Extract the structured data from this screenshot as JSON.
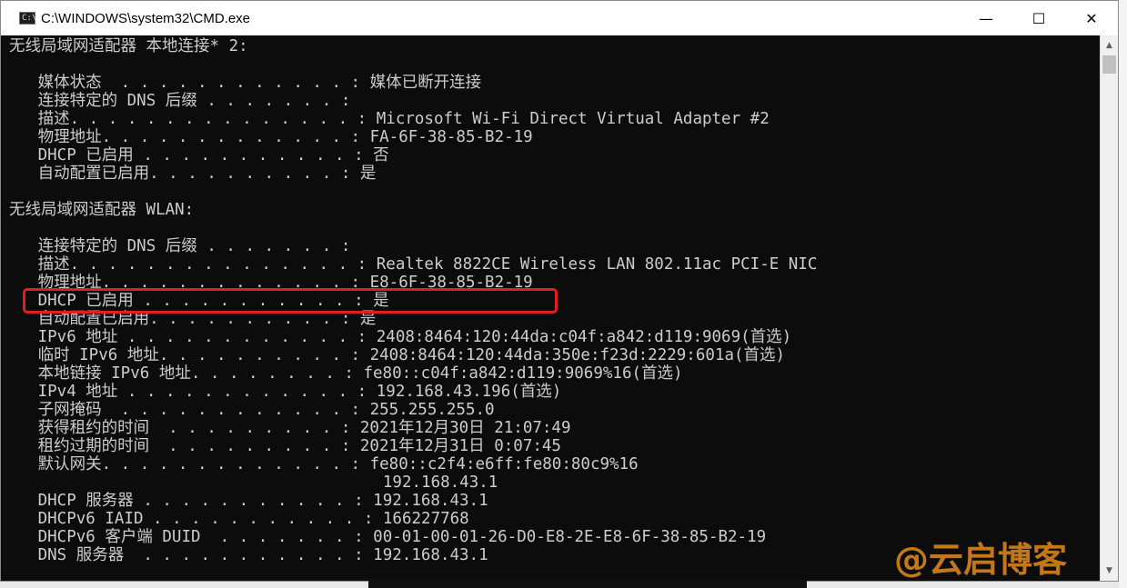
{
  "window": {
    "title": "C:\\WINDOWS\\system32\\CMD.exe",
    "app_icon_text": "C:\\",
    "minimize": "—",
    "maximize": "☐",
    "close": "✕"
  },
  "console": {
    "lines": [
      "无线局域网适配器 本地连接* 2:",
      "",
      "   媒体状态  . . . . . . . . . . . . : 媒体已断开连接",
      "   连接特定的 DNS 后缀 . . . . . . . :",
      "   描述. . . . . . . . . . . . . . . : Microsoft Wi-Fi Direct Virtual Adapter #2",
      "   物理地址. . . . . . . . . . . . . : FA-6F-38-85-B2-19",
      "   DHCP 已启用 . . . . . . . . . . . : 否",
      "   自动配置已启用. . . . . . . . . . : 是",
      "",
      "无线局域网适配器 WLAN:",
      "",
      "   连接特定的 DNS 后缀 . . . . . . . :",
      "   描述. . . . . . . . . . . . . . . : Realtek 8822CE Wireless LAN 802.11ac PCI-E NIC",
      "   物理地址. . . . . . . . . . . . . : E8-6F-38-85-B2-19",
      "   DHCP 已启用 . . . . . . . . . . . : 是",
      "   自动配置已启用. . . . . . . . . . : 是",
      "   IPv6 地址 . . . . . . . . . . . . : 2408:8464:120:44da:c04f:a842:d119:9069(首选)",
      "   临时 IPv6 地址. . . . . . . . . . : 2408:8464:120:44da:350e:f23d:2229:601a(首选)",
      "   本地链接 IPv6 地址. . . . . . . . : fe80::c04f:a842:d119:9069%16(首选)",
      "   IPv4 地址 . . . . . . . . . . . . : 192.168.43.196(首选)",
      "   子网掩码  . . . . . . . . . . . . : 255.255.255.0",
      "   获得租约的时间  . . . . . . . . . : 2021年12月30日 21:07:49",
      "   租约过期的时间  . . . . . . . . . : 2021年12月31日 0:07:45",
      "   默认网关. . . . . . . . . . . . . : fe80::c2f4:e6ff:fe80:80c9%16",
      "                                       192.168.43.1",
      "   DHCP 服务器 . . . . . . . . . . . : 192.168.43.1",
      "   DHCPv6 IAID . . . . . . . . . . . : 166227768",
      "   DHCPv6 客户端 DUID  . . . . . . . : 00-01-00-01-26-D0-E8-2E-E8-6F-38-85-B2-19",
      "   DNS 服务器  . . . . . . . . . . . : 192.168.43.1"
    ]
  },
  "scrollbar": {
    "up": "▲",
    "down": "▼"
  },
  "watermark": "@云启博客",
  "colors": {
    "console_bg": "#0c0c0c",
    "console_fg": "#cccccc",
    "highlight": "#e02020",
    "watermark": "#e38a1a"
  }
}
